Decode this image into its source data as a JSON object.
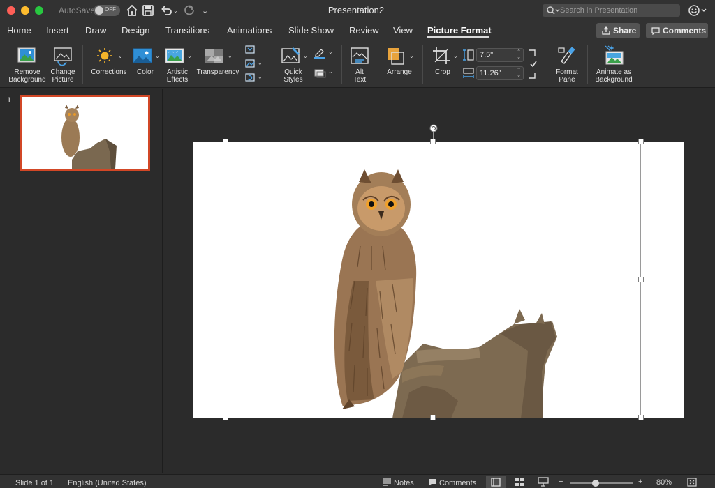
{
  "titlebar": {
    "autosave_label": "AutoSave",
    "autosave_state": "OFF",
    "document_title": "Presentation2",
    "search_placeholder": "Search in Presentation",
    "traffic_colors": [
      "#ff5f57",
      "#febc2e",
      "#28c840"
    ]
  },
  "tabs": {
    "items": [
      "Home",
      "Insert",
      "Draw",
      "Design",
      "Transitions",
      "Animations",
      "Slide Show",
      "Review",
      "View",
      "Picture Format"
    ],
    "active": "Picture Format",
    "share_label": "Share",
    "comments_label": "Comments"
  },
  "ribbon": {
    "remove_background": "Remove\nBackground",
    "change_picture": "Change\nPicture",
    "corrections": "Corrections",
    "color": "Color",
    "artistic_effects": "Artistic\nEffects",
    "transparency": "Transparency",
    "quick_styles": "Quick\nStyles",
    "alt_text": "Alt\nText",
    "arrange": "Arrange",
    "crop": "Crop",
    "height_value": "7.5\"",
    "width_value": "11.26\"",
    "format_pane": "Format\nPane",
    "animate_as_background": "Animate as\nBackground",
    "accent_color": "#e8a33c"
  },
  "slides_pane": {
    "slide_number": "1",
    "selected_border_color": "#d24726"
  },
  "status": {
    "slide_info": "Slide 1 of 1",
    "language": "English (United States)",
    "notes_label": "Notes",
    "comments_label": "Comments",
    "zoom_minus": "−",
    "zoom_plus": "+",
    "zoom_level": "80%",
    "zoom_fraction": 0.4
  }
}
